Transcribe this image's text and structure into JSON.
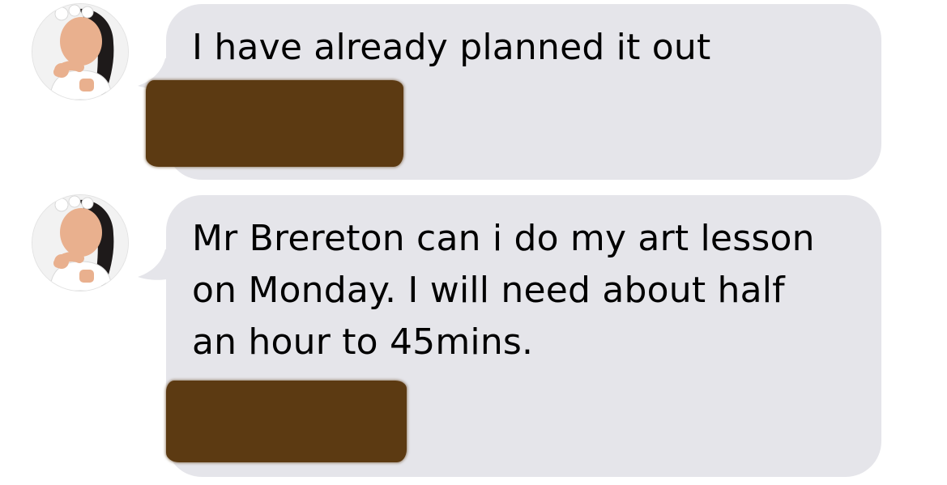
{
  "conversation": {
    "messages": [
      {
        "sender": "avatar",
        "text": "I have already planned it out"
      },
      {
        "sender": "avatar",
        "text": "Mr Brereton can i do my art lesson on Monday. I will need about half an hour to 45mins."
      }
    ]
  },
  "colors": {
    "bubble": "#e5e5ea",
    "text": "#000000",
    "redaction": "#5c3a12",
    "background": "#ffffff"
  },
  "icons": {
    "avatar": "user-avatar-icon"
  }
}
